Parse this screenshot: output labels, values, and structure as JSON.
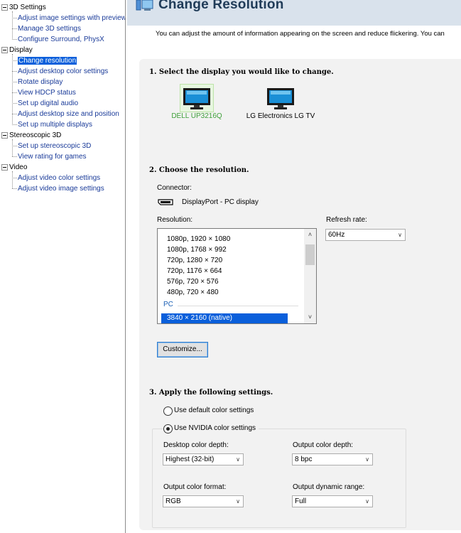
{
  "tree": {
    "groups": [
      {
        "label": "3D Settings",
        "children": [
          "Adjust image settings with preview",
          "Manage 3D settings",
          "Configure Surround, PhysX"
        ]
      },
      {
        "label": "Display",
        "children": [
          "Change resolution",
          "Adjust desktop color settings",
          "Rotate display",
          "View HDCP status",
          "Set up digital audio",
          "Adjust desktop size and position",
          "Set up multiple displays"
        ]
      },
      {
        "label": "Stereoscopic 3D",
        "children": [
          "Set up stereoscopic 3D",
          "View rating for games"
        ]
      },
      {
        "label": "Video",
        "children": [
          "Adjust video color settings",
          "Adjust video image settings"
        ]
      }
    ],
    "selected": "Change resolution"
  },
  "header": {
    "title": "Change Resolution",
    "description": "You can adjust the amount of information appearing on the screen and reduce flickering. You can"
  },
  "step1": {
    "title": "1. Select the display you would like to change.",
    "displays": [
      {
        "label": "DELL UP3216Q",
        "selected": true
      },
      {
        "label": "LG Electronics LG TV",
        "selected": false
      }
    ]
  },
  "step2": {
    "title": "2. Choose the resolution.",
    "connector_label": "Connector:",
    "connector_value": "DisplayPort - PC display",
    "resolution_label": "Resolution:",
    "resolutions": [
      "1080p, 1920 × 1080",
      "1080p, 1768 × 992",
      "720p, 1280 × 720",
      "720p, 1176 × 664",
      "576p, 720 × 576",
      "480p, 720 × 480"
    ],
    "pc_group": "PC",
    "selected_resolution": "3840 × 2160 (native)",
    "refresh_label": "Refresh rate:",
    "refresh_value": "60Hz",
    "customize_label": "Customize..."
  },
  "step3": {
    "title": "3. Apply the following settings.",
    "radio_default": "Use default color settings",
    "radio_nvidia": "Use NVIDIA color settings",
    "selected_radio": "nvidia",
    "desktop_depth_label": "Desktop color depth:",
    "desktop_depth_value": "Highest (32-bit)",
    "output_depth_label": "Output color depth:",
    "output_depth_value": "8 bpc",
    "output_format_label": "Output color format:",
    "output_format_value": "RGB",
    "output_range_label": "Output dynamic range:",
    "output_range_value": "Full"
  },
  "colors": {
    "selection": "#0a5fdb",
    "link": "#1a3b99",
    "selected_display_text": "#3fa03a",
    "header_bg": "#d9e2ec",
    "panel_bg": "#f2f2f2"
  }
}
